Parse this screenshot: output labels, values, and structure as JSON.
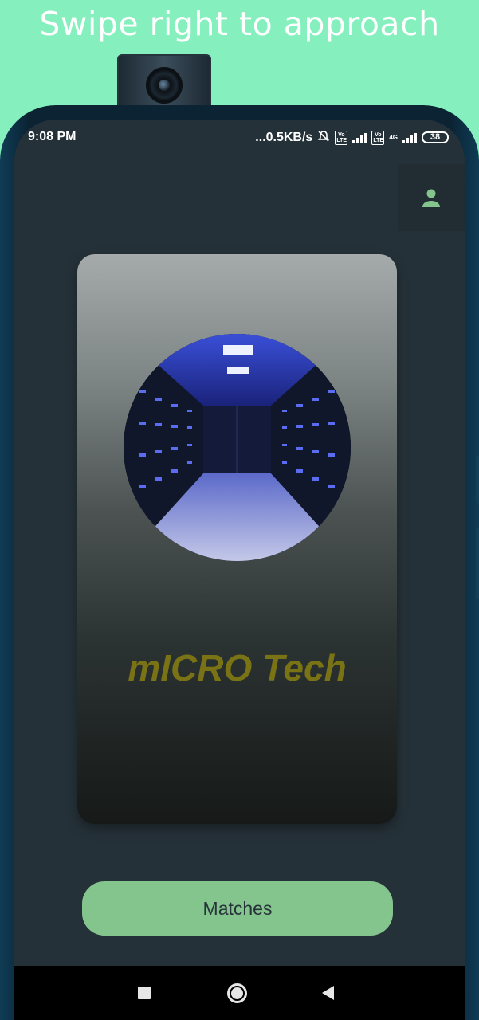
{
  "banner": {
    "text": "Swipe right to approach"
  },
  "status_bar": {
    "time": "9:08 PM",
    "speed": "...0.5KB/s",
    "volte1": "Vo LTE",
    "volte2": "Vo LTE",
    "network": "4G",
    "battery": "38"
  },
  "header": {
    "profile_icon": "person-icon"
  },
  "card": {
    "title": "mICRO Tech",
    "image_icon": "server-room-image"
  },
  "actions": {
    "matches_label": "Matches"
  },
  "navigation": {
    "icons": [
      "recents-square-icon",
      "home-circle-icon",
      "back-triangle-icon"
    ]
  },
  "colors": {
    "background": "#86efbe",
    "screen": "#253138",
    "card_title": "#7a7316",
    "button": "#84c48d",
    "profile_icon": "#84c48d"
  }
}
